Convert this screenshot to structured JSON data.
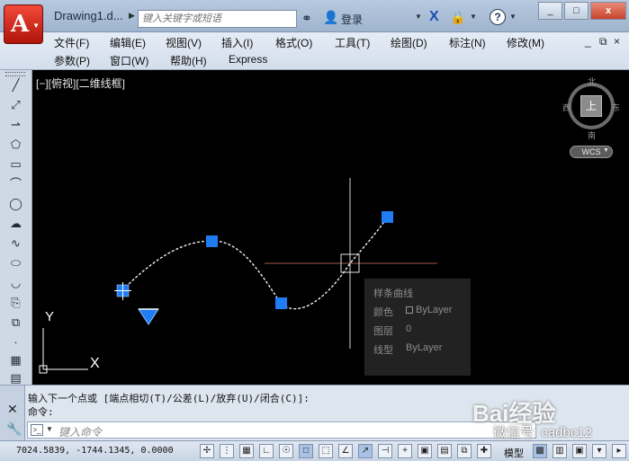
{
  "title_bar": {
    "doc_title": "Drawing1.d...",
    "search_placeholder": "键入关键字或短语",
    "login": "登录",
    "icons": [
      "binocular-icon",
      "user-icon",
      "exchange-x-icon",
      "lock-icon",
      "help-icon"
    ],
    "help_glyph": "?"
  },
  "window_controls": {
    "minimize": "_",
    "restore": "□",
    "close": "x"
  },
  "menu": {
    "row1": [
      "文件(F)",
      "编辑(E)",
      "视图(V)",
      "插入(I)",
      "格式(O)",
      "工具(T)",
      "绘图(D)",
      "标注(N)",
      "修改(M)"
    ],
    "row2": [
      "参数(P)",
      "窗口(W)",
      "帮助(H)",
      "Express"
    ],
    "doc_controls": {
      "minimize": "_",
      "restore": "⧉",
      "close": "×"
    }
  },
  "viewport": {
    "label": "[−][俯视][二维线框]",
    "compass": {
      "north": "北",
      "south": "南",
      "east": "东",
      "west": "西",
      "cube_face": "上",
      "wcs": "WCS"
    },
    "ucs_x": "X",
    "ucs_y": "Y"
  },
  "tooltip": {
    "title": "样条曲线",
    "rows": [
      {
        "key": "颜色",
        "value": "ByLayer"
      },
      {
        "key": "图层",
        "value": "0"
      },
      {
        "key": "线型",
        "value": "ByLayer"
      }
    ]
  },
  "command": {
    "history_line": "输入下一个点或 [端点相切(T)/公差(L)/放弃(U)/闭合(C)]:",
    "current_line": "命令:",
    "input_placeholder": "键入命令"
  },
  "status": {
    "coordinates": "7024.5839, -1744.1345, 0.0000",
    "model": "模型"
  },
  "watermark": {
    "brand": "Bai经验",
    "handle": "微信号: cadbc12"
  },
  "colors": {
    "canvas": "#000000",
    "grip": "#1f7cf2",
    "spline": "#ffffff",
    "crosshair_h": "#a05a4a"
  }
}
